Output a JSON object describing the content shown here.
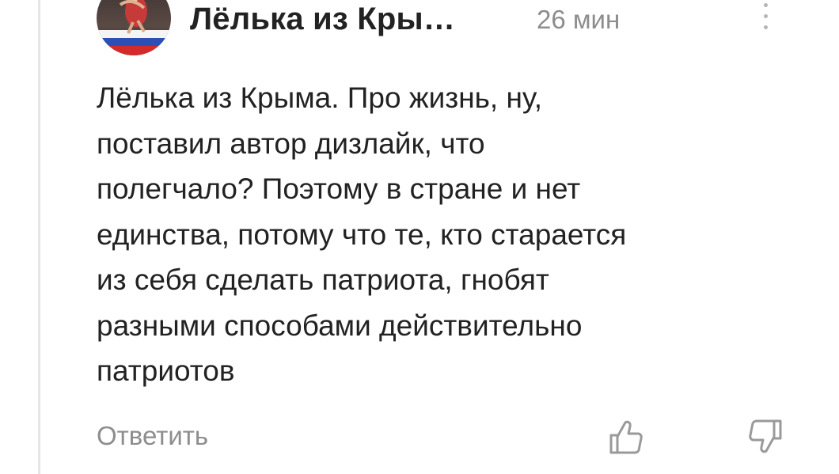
{
  "comment": {
    "author": "Лёлька из Кры…",
    "time": "26 мин",
    "text": "Лёлька из Крыма. Про жизнь, ну,\nпоставил автор дизлайк, что\nполегчало? Поэтому в стране и нет\nединства, потому что те, кто старается\nиз себя сделать патриота, гнобят\nразными способами действительно\nпатриотов",
    "reply_label": "Ответить",
    "avatar_icon": "user-avatar-photo",
    "more_icon": "more-vertical-icon",
    "like_icon": "thumbs-up-icon",
    "dislike_icon": "thumbs-down-icon"
  },
  "colors": {
    "text": "#222222",
    "muted": "#8d8d8d",
    "thread_line": "#e6e6e6"
  }
}
